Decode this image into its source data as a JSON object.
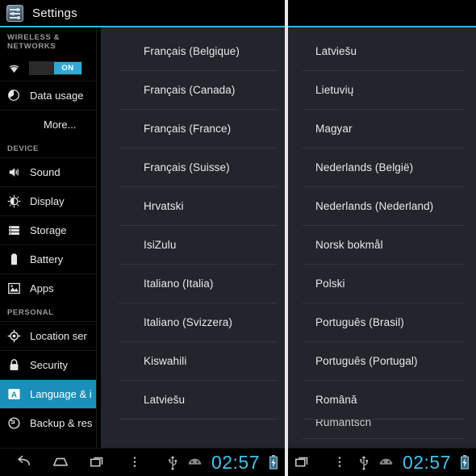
{
  "app": {
    "title": "Settings",
    "icon": "settings-sliders-icon",
    "accent_color": "#33b5e5",
    "panel_background": "#22252b",
    "selected_color": "#1a8fba"
  },
  "sidebar": {
    "sections": [
      {
        "header": "WIRELESS & NETWORKS",
        "items": [
          {
            "label": "",
            "icon": "wifi-icon",
            "type": "toggle",
            "toggle_label": "ON",
            "toggle_state": "on"
          },
          {
            "label": "Data usage",
            "icon": "data-usage-icon",
            "type": "item"
          },
          {
            "label": "More...",
            "icon": "none",
            "type": "item-indent"
          }
        ]
      },
      {
        "header": "DEVICE",
        "items": [
          {
            "label": "Sound",
            "icon": "sound-icon",
            "type": "item"
          },
          {
            "label": "Display",
            "icon": "display-icon",
            "type": "item"
          },
          {
            "label": "Storage",
            "icon": "storage-icon",
            "type": "item"
          },
          {
            "label": "Battery",
            "icon": "battery-icon",
            "type": "item"
          },
          {
            "label": "Apps",
            "icon": "apps-icon",
            "type": "item"
          }
        ]
      },
      {
        "header": "PERSONAL",
        "items": [
          {
            "label": "Location ser",
            "icon": "location-icon",
            "type": "item"
          },
          {
            "label": "Security",
            "icon": "lock-icon",
            "type": "item"
          },
          {
            "label": "Language & i",
            "icon": "language-icon",
            "type": "item",
            "selected": true
          },
          {
            "label": "Backup & res",
            "icon": "backup-icon",
            "type": "item"
          }
        ]
      }
    ]
  },
  "language_list_left": {
    "items": [
      {
        "name": "Français (Belgique)"
      },
      {
        "name": "Français (Canada)"
      },
      {
        "name": "Français (France)"
      },
      {
        "name": "Français (Suisse)"
      },
      {
        "name": "Hrvatski"
      },
      {
        "name": "IsiZulu"
      },
      {
        "name": "Italiano (Italia)"
      },
      {
        "name": "Italiano (Svizzera)"
      },
      {
        "name": "Kiswahili"
      },
      {
        "name": "Latviešu"
      }
    ]
  },
  "language_list_right": {
    "items": [
      {
        "name": "Latviešu"
      },
      {
        "name": "Lietuvių"
      },
      {
        "name": "Magyar"
      },
      {
        "name": "Nederlands (België)"
      },
      {
        "name": "Nederlands (Nederland)"
      },
      {
        "name": "Norsk bokmål"
      },
      {
        "name": "Polski"
      },
      {
        "name": "Português (Brasil)"
      },
      {
        "name": "Português (Portugal)"
      },
      {
        "name": "Română"
      },
      {
        "name": "Rumantsch",
        "partial": true
      }
    ]
  },
  "system_bar": {
    "nav": [
      {
        "name": "back-icon"
      },
      {
        "name": "home-icon"
      },
      {
        "name": "recents-icon"
      },
      {
        "name": "menu-overflow-icon"
      }
    ],
    "status": {
      "usb_icon": "usb-icon",
      "android_icon": "android-robot-icon",
      "clock": "02:57",
      "battery_icon": "battery-charging-icon",
      "clock_color": "#46c2ea"
    }
  },
  "system_bar_right": {
    "nav": [
      {
        "name": "recents-icon"
      },
      {
        "name": "menu-overflow-icon"
      }
    ],
    "status": {
      "usb_icon": "usb-icon",
      "android_icon": "android-robot-icon",
      "clock": "02:57",
      "battery_icon": "battery-charging-icon"
    }
  }
}
